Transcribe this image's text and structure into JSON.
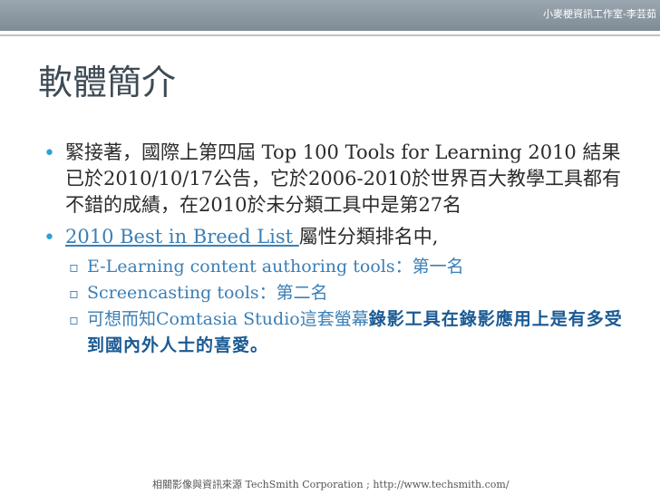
{
  "header": {
    "author": "小麥梗資訊工作室-李芸茹"
  },
  "slide": {
    "title": "軟體簡介"
  },
  "bullets": {
    "b1": "緊接著，國際上第四屆 Top 100 Tools for Learning 2010 結果已於2010/10/17公告，它於2006-2010於世界百大教學工具都有不錯的成績，在2010於未分類工具中是第27名",
    "b2_link": "2010 Best in Breed List ",
    "b2_rest": "屬性分類排名中,",
    "sub1": "E-Learning content authoring tools：第一名",
    "sub2": "Screencasting tools：第二名",
    "sub3_a": "可想而知Comtasia Studio這套螢幕",
    "sub3_b": "錄影工具在錄影應用上是有多受到國內外人士的喜愛。"
  },
  "footer": {
    "source": "相關影像與資訊來源 TechSmith Corporation ; http://www.techsmith.com/"
  },
  "colors": {
    "accent": "#2e9fd7",
    "link": "#3b7fb6",
    "band": "#8893a0"
  }
}
